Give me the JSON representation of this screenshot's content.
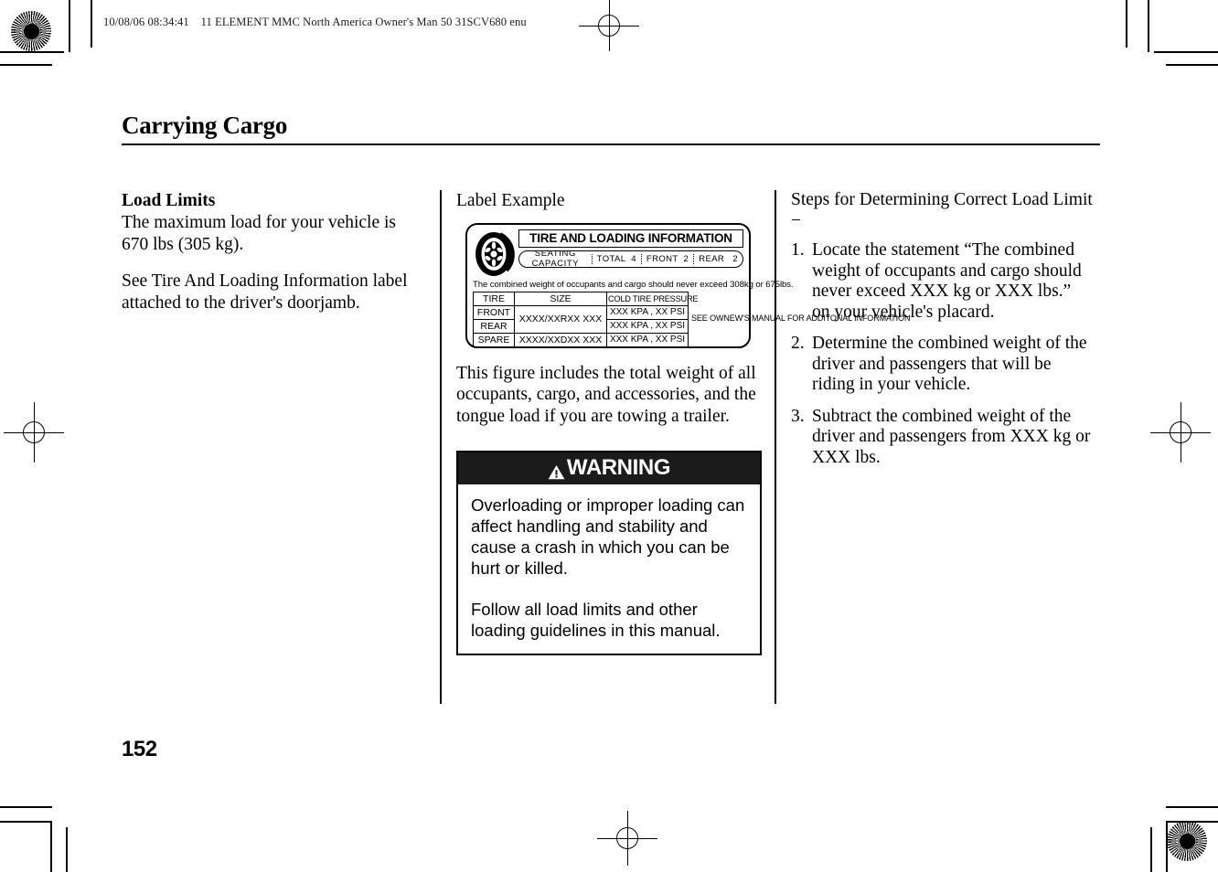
{
  "running_head": "10/08/06 08:34:41    11 ELEMENT MMC North America Owner's Man 50 31SCV680 enu",
  "chapter_title": "Carrying Cargo",
  "folio": "152",
  "column_left": {
    "heading": "Load Limits",
    "paragraph_1": "The maximum load for your vehicle is 670 lbs (305 kg).",
    "paragraph_2": "See Tire And Loading Information label attached to the driver's doorjamb."
  },
  "column_middle": {
    "figure_caption": "Label Example",
    "label": {
      "title": "TIRE AND LOADING INFORMATION",
      "seating_capacity_label": "SEATING  CAPACITY",
      "seating_cells": [
        "TOTAL  4",
        "FRONT  2",
        "REAR   2"
      ],
      "combined_weight_note": "The combined weight of occupants and cargo should never exceed 308kg or 675lbs.",
      "table_headers": [
        "TIRE",
        "SIZE",
        "COLD TIRE PRESSURE"
      ],
      "rows": [
        {
          "tire": "FRONT",
          "size": "XXXX/XXRXX XXX",
          "pressure": "XXX KPA , XX PSI"
        },
        {
          "tire": "REAR",
          "size": "",
          "pressure": "XXX KPA , XX PSI"
        },
        {
          "tire": "SPARE",
          "size": "XXXX/XXDXX XXX",
          "pressure": "XXX KPA , XX PSI"
        }
      ],
      "side_note": "SEE OWNEW'S MANUAL FOR ADDITONAL INFORMATION"
    },
    "paragraph": "This figure includes the total weight of all occupants, cargo, and accessories, and the tongue load if you are towing a trailer.",
    "warning": {
      "title": "WARNING",
      "body_1": "Overloading or improper loading can affect handling and stability and cause a crash in which you can be hurt or killed.",
      "body_2": "Follow all load limits and other loading guidelines in this manual."
    }
  },
  "column_right": {
    "heading": "Steps for Determining Correct Load Limit −",
    "steps": [
      {
        "num": "1.",
        "text": "Locate the statement “The combined weight of occupants and cargo should never exceed XXX kg or XXX lbs.” on your vehicle's placard."
      },
      {
        "num": "2.",
        "text": "Determine the combined weight of the driver and passengers that will be riding in your vehicle."
      },
      {
        "num": "3.",
        "text": "Subtract the combined weight of the driver and passengers from XXX kg or XXX lbs."
      }
    ]
  }
}
